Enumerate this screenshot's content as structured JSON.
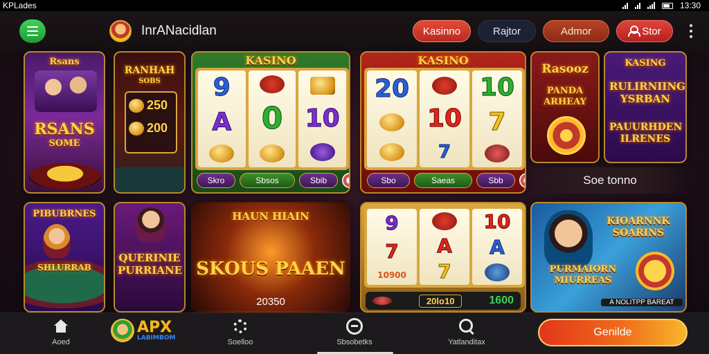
{
  "status_bar": {
    "left_text": "KPLades",
    "time": "13:30"
  },
  "top_bar": {
    "title": "InrANacidlan",
    "nav": [
      "Kasinno",
      "Rajtor",
      "Admor",
      "Stor"
    ]
  },
  "tiles": {
    "t1": {
      "label_top": "Rsans",
      "label_main": "RSANS",
      "label_sub": "SOME"
    },
    "t2": {
      "label_top": "RANHAH",
      "label_sub": "SOBS",
      "val1": "250",
      "val2": "200"
    },
    "t3": {
      "header": "KASINO",
      "reels": [
        [
          "9",
          "A",
          ""
        ],
        [
          "",
          "0",
          ""
        ],
        [
          "",
          "10",
          ""
        ]
      ],
      "buttons": [
        "Skro",
        "Sbsos",
        "Sbib"
      ]
    },
    "t4": {
      "header": "KASINO",
      "reels": [
        [
          "20",
          "",
          ""
        ],
        [
          "",
          "10",
          ""
        ],
        [
          "10",
          "7",
          ""
        ]
      ],
      "buttons": [
        "Sbo",
        "Saeas",
        "Sbb"
      ]
    },
    "t5": {
      "title": "Rasooz",
      "sub": "PANDA ARHEAY"
    },
    "t6": {
      "title": "KASING",
      "line1": "RULIRNIING YSRBAN",
      "line2": "PAUURHDEN ILRENES"
    },
    "banner_text": "Soe tonno",
    "t7": {
      "title": "PIBUBRNES",
      "bottom": "SHLURRAB"
    },
    "t8": {
      "title": "QUERINIE PURRIANE"
    },
    "t9": {
      "top": "HAUN HIAIN",
      "main": "SKOUS PAAEN",
      "amount": "20350"
    },
    "t10": {
      "reels": [
        [
          "9",
          "7",
          "10900"
        ],
        [
          "",
          "A",
          "7"
        ],
        [
          "10",
          "A",
          ""
        ]
      ],
      "bottom_mid": "20lo10",
      "bottom_right": "1600"
    },
    "t11": {
      "title": "KIOARNNK SOARINS",
      "sub": "PURMAIORN MIURREAS",
      "footer": "A NOLITPP BAREAT"
    }
  },
  "bottom_nav": {
    "items": [
      "Aoed",
      "Soelloo",
      "Sbsobetks",
      "Yatlanditax"
    ],
    "brand_main": "APX",
    "brand_sub": "LABIMBOM",
    "cta": "Genilde"
  },
  "colors": {
    "accent_red": "#e54a3a",
    "accent_green": "#3fd25a",
    "gold": "#b98a2c"
  }
}
